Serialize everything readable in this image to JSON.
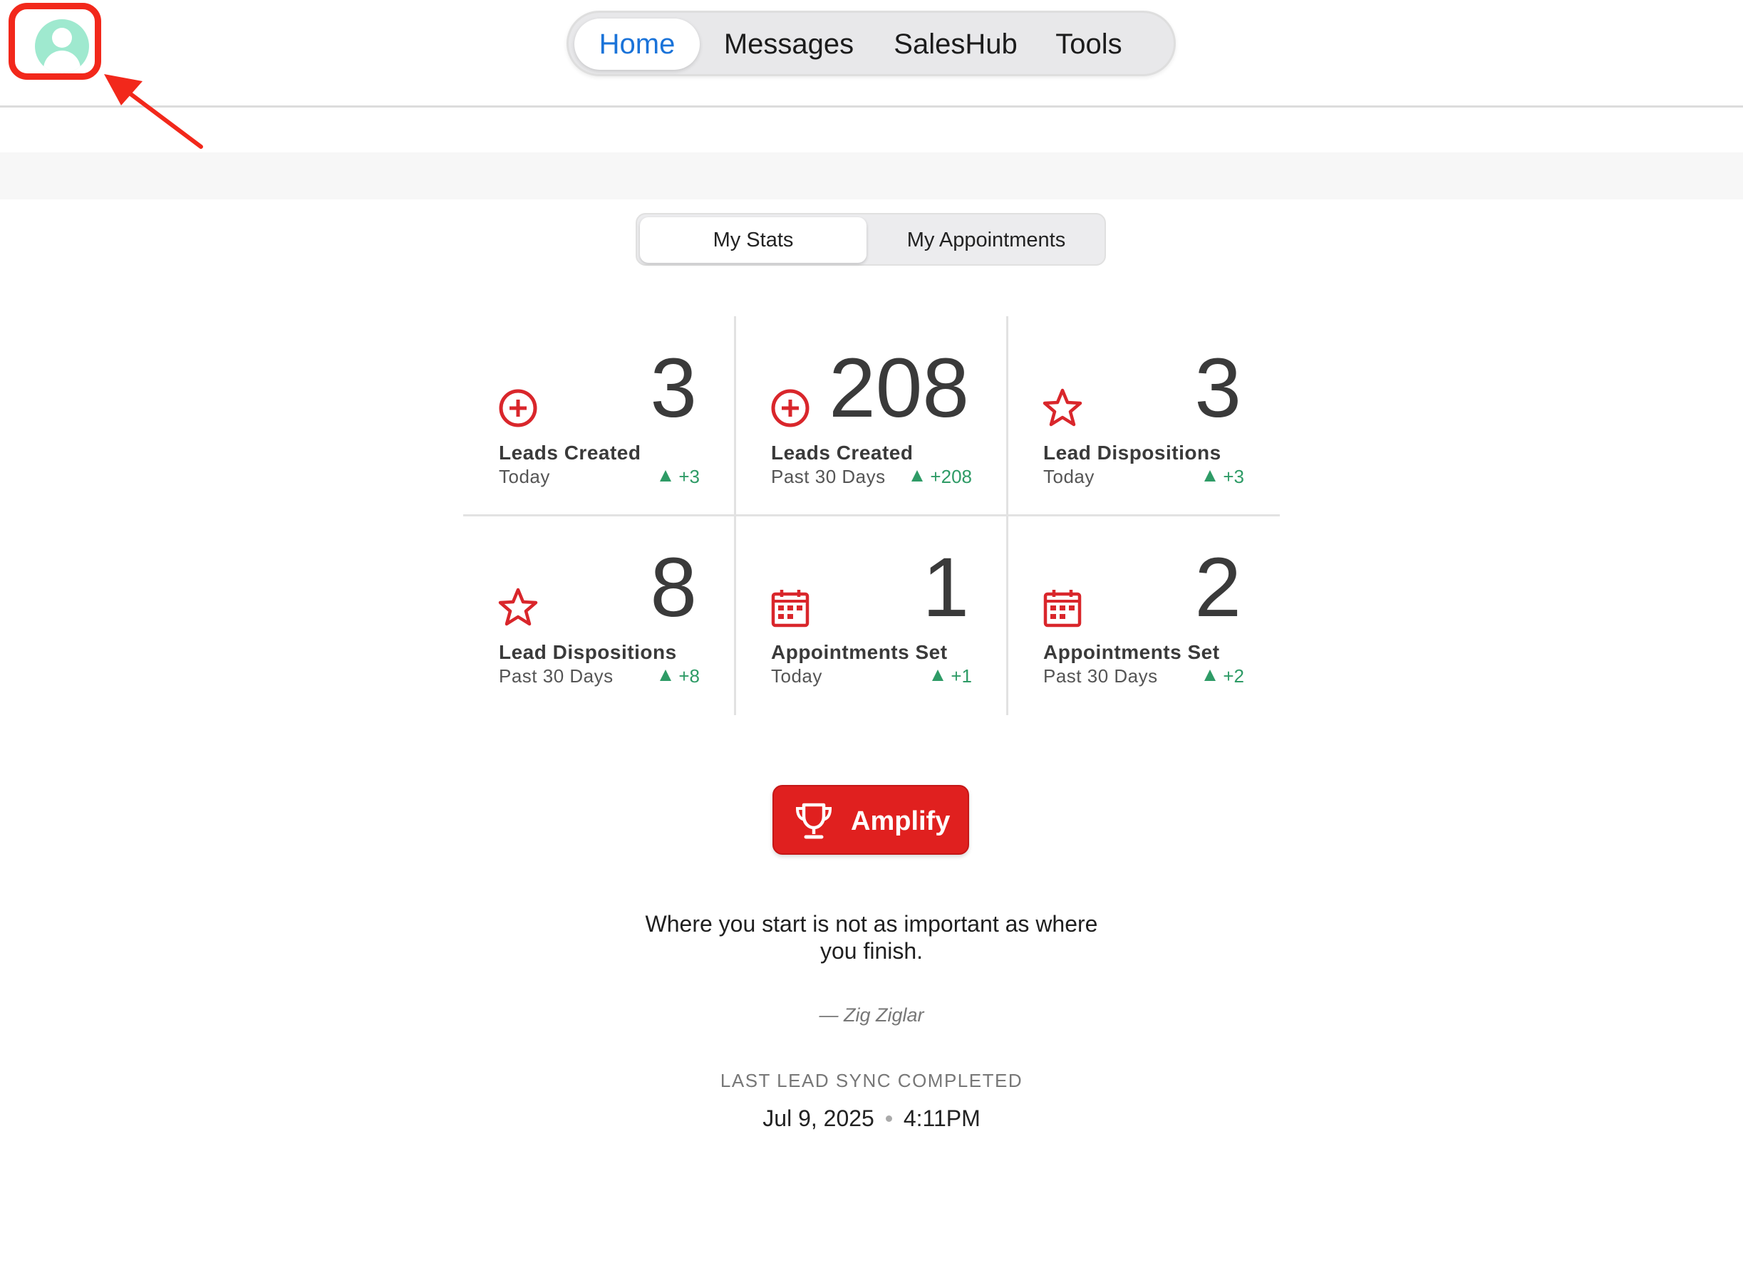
{
  "nav": {
    "tabs": [
      "Home",
      "Messages",
      "SalesHub",
      "Tools"
    ],
    "active": "Home"
  },
  "segments": {
    "items": [
      "My Stats",
      "My Appointments"
    ],
    "active": "My Stats"
  },
  "stats": [
    {
      "value": "3",
      "label": "Leads Created",
      "period": "Today",
      "delta": "+3",
      "icon": "plus-circle-icon"
    },
    {
      "value": "208",
      "label": "Leads Created",
      "period": "Past 30 Days",
      "delta": "+208",
      "icon": "plus-circle-icon"
    },
    {
      "value": "3",
      "label": "Lead Dispositions",
      "period": "Today",
      "delta": "+3",
      "icon": "star-icon"
    },
    {
      "value": "8",
      "label": "Lead Dispositions",
      "period": "Past 30 Days",
      "delta": "+8",
      "icon": "star-icon"
    },
    {
      "value": "1",
      "label": "Appointments Set",
      "period": "Today",
      "delta": "+1",
      "icon": "calendar-icon"
    },
    {
      "value": "2",
      "label": "Appointments Set",
      "period": "Past 30 Days",
      "delta": "+2",
      "icon": "calendar-icon"
    }
  ],
  "amplify": {
    "label": "Amplify"
  },
  "quote": {
    "text": "Where you start is not as important as where you finish.",
    "author": "— Zig Ziglar"
  },
  "sync": {
    "title": "LAST LEAD SYNC COMPLETED",
    "date": "Jul 9, 2025",
    "time": "4:11PM"
  },
  "colors": {
    "accent_blue": "#1a73d9",
    "brand_red": "#e0201f",
    "positive_green": "#2e9b66",
    "annotation_red": "#f2281b",
    "avatar_green": "#9fe9cf"
  }
}
